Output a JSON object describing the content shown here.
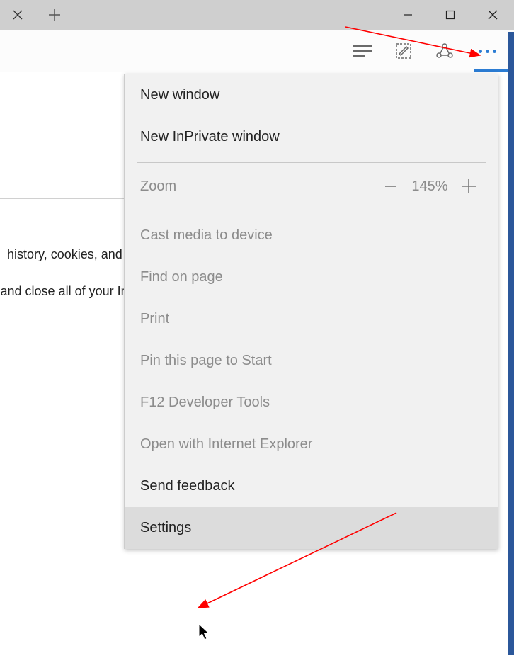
{
  "titlebar": {
    "window_controls": {
      "minimize_title": "Minimize",
      "maximize_title": "Maximize",
      "close_title": "Close"
    }
  },
  "page_behind": {
    "line1": "history, cookies, and temporary files) isn't saved o",
    "line2": "you're finished and close all of your InPrivate ta"
  },
  "menu": {
    "new_window": "New window",
    "new_inprivate": "New InPrivate window",
    "zoom_label": "Zoom",
    "zoom_value": "145%",
    "cast": "Cast media to device",
    "find": "Find on page",
    "print": "Print",
    "pin": "Pin this page to Start",
    "devtools": "F12 Developer Tools",
    "open_ie": "Open with Internet Explorer",
    "feedback": "Send feedback",
    "settings": "Settings"
  }
}
